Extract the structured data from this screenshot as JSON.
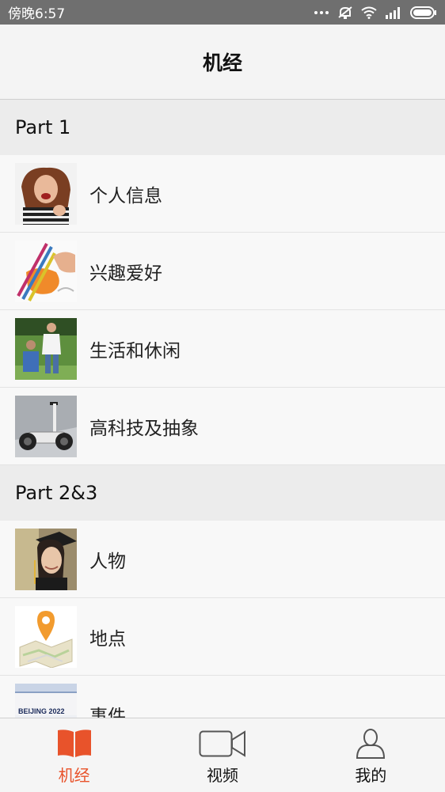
{
  "status_bar": {
    "time": "傍晚6:57",
    "icons": [
      "more-dots-icon",
      "mute-icon",
      "wifi-icon",
      "signal-icon",
      "battery-icon"
    ]
  },
  "header": {
    "title": "机经"
  },
  "sections": [
    {
      "title": "Part 1",
      "items": [
        {
          "label": "个人信息",
          "icon": "personal-info-photo"
        },
        {
          "label": "兴趣爱好",
          "icon": "hobbies-photo"
        },
        {
          "label": "生活和休闲",
          "icon": "life-leisure-photo"
        },
        {
          "label": "高科技及抽象",
          "icon": "hitech-photo"
        }
      ]
    },
    {
      "title": "Part 2&3",
      "items": [
        {
          "label": "人物",
          "icon": "person-photo"
        },
        {
          "label": "地点",
          "icon": "map-pin-photo"
        },
        {
          "label": "事件",
          "icon": "event-photo",
          "thumb_text": "BEIJING 2022"
        }
      ]
    }
  ],
  "tabs": [
    {
      "label": "机经",
      "icon": "book-icon",
      "active": true
    },
    {
      "label": "视频",
      "icon": "video-camera-icon",
      "active": false
    },
    {
      "label": "我的",
      "icon": "user-icon",
      "active": false
    }
  ],
  "colors": {
    "accent": "#e8532b",
    "status_bar": "#6f6f6f",
    "section_bg": "#ececec"
  }
}
